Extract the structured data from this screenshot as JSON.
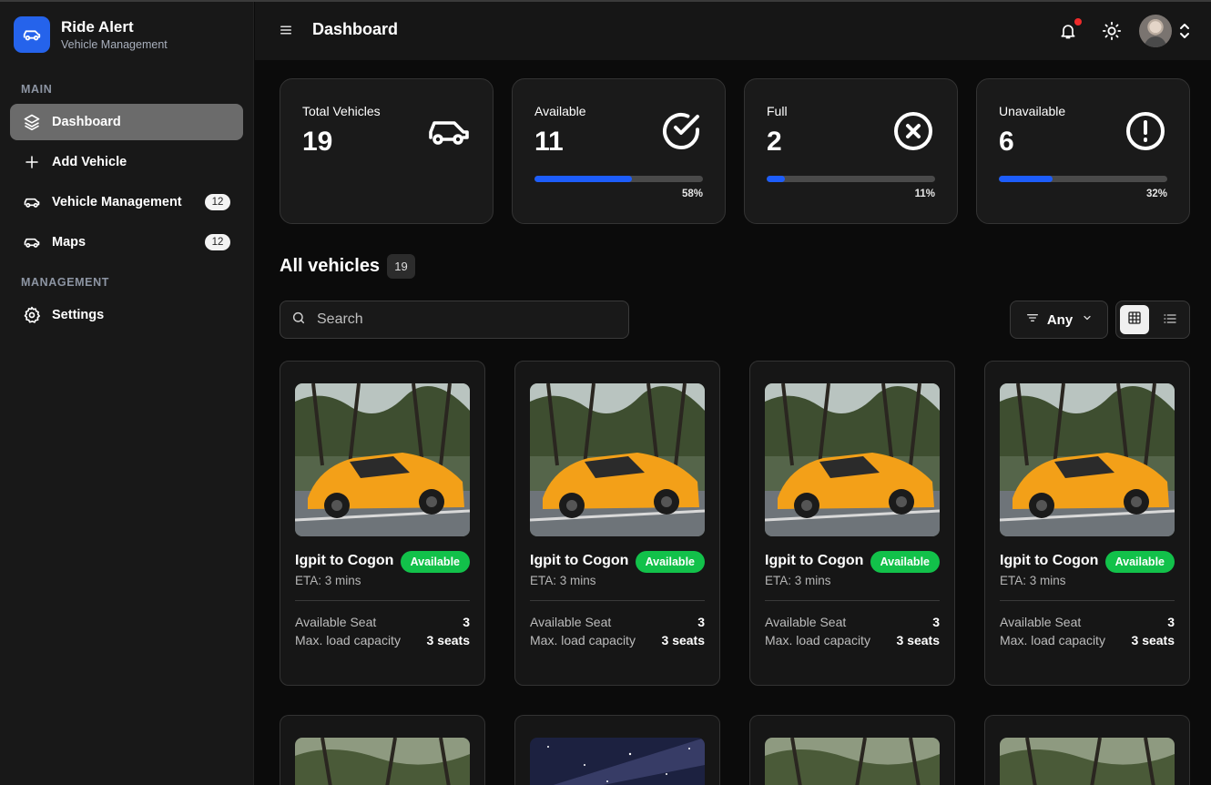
{
  "brand": {
    "name": "Ride Alert",
    "subtitle": "Vehicle Management"
  },
  "sidebar": {
    "main_label": "MAIN",
    "management_label": "MANAGEMENT",
    "items": [
      {
        "label": "Dashboard",
        "icon": "layers-icon",
        "active": true
      },
      {
        "label": "Add Vehicle",
        "icon": "plus-icon"
      },
      {
        "label": "Vehicle Management",
        "icon": "car-icon",
        "badge": "12"
      },
      {
        "label": "Maps",
        "icon": "car-icon",
        "badge": "12"
      },
      {
        "label": "Settings",
        "icon": "gear-icon"
      }
    ]
  },
  "header": {
    "title": "Dashboard"
  },
  "stats": [
    {
      "title": "Total Vehicles",
      "value": "19",
      "icon": "car-icon"
    },
    {
      "title": "Available",
      "value": "11",
      "icon": "check-circle-icon",
      "percent_label": "58%",
      "percent": 58
    },
    {
      "title": "Full",
      "value": "2",
      "icon": "x-circle-icon",
      "percent_label": "11%",
      "percent": 11
    },
    {
      "title": "Unavailable",
      "value": "6",
      "icon": "alert-circle-icon",
      "percent_label": "32%",
      "percent": 32
    }
  ],
  "vehicles_section": {
    "title": "All vehicles",
    "count": "19"
  },
  "search": {
    "placeholder": "Search",
    "value": ""
  },
  "filter": {
    "label": "Any"
  },
  "vehicles": [
    {
      "name": "Igpit to Cogon",
      "status": "Available",
      "eta": "ETA: 3 mins",
      "seat_label": "Available Seat",
      "seat_value": "3",
      "load_label": "Max. load capacity",
      "load_value": "3 seats"
    },
    {
      "name": "Igpit to Cogon",
      "status": "Available",
      "eta": "ETA: 3 mins",
      "seat_label": "Available Seat",
      "seat_value": "3",
      "load_label": "Max. load capacity",
      "load_value": "3 seats"
    },
    {
      "name": "Igpit to Cogon",
      "status": "Available",
      "eta": "ETA: 3 mins",
      "seat_label": "Available Seat",
      "seat_value": "3",
      "load_label": "Max. load capacity",
      "load_value": "3 seats"
    },
    {
      "name": "Igpit to Cogon",
      "status": "Available",
      "eta": "ETA: 3 mins",
      "seat_label": "Available Seat",
      "seat_value": "3",
      "load_label": "Max. load capacity",
      "load_value": "3 seats"
    }
  ],
  "colors": {
    "accent": "#2563eb",
    "progress": "#1d5dfb",
    "available": "#12c14a",
    "notification": "#ef2b2b"
  }
}
